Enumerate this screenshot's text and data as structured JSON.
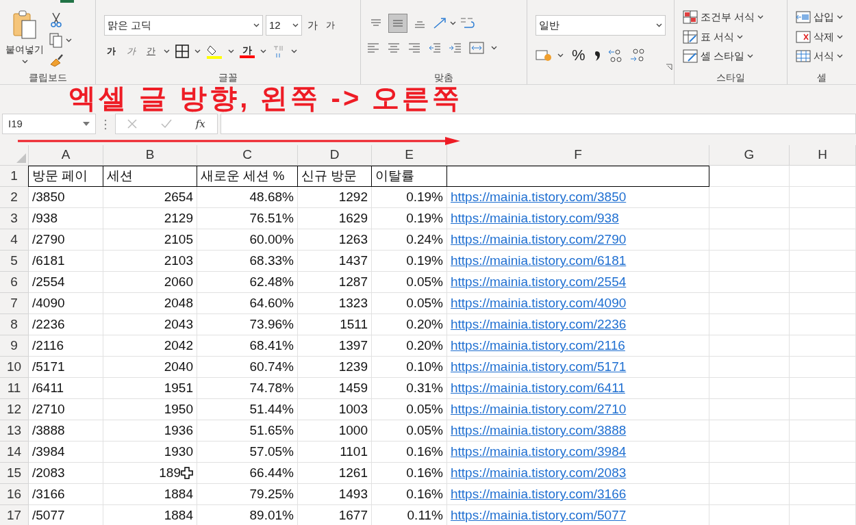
{
  "ribbon": {
    "clipboard": {
      "paste": "붙여넣기",
      "label": "클립보드"
    },
    "font": {
      "font_name": "맑은 고딕",
      "font_size": "12",
      "grow": "가",
      "shrink": "가",
      "bold": "가",
      "italic": "가",
      "underline": "간",
      "font_color": "가",
      "label": "글꼴"
    },
    "alignment": {
      "vertical": [
        {
          "selected": false
        },
        {
          "selected": true
        },
        {
          "selected": false
        }
      ],
      "label": "맞춤"
    },
    "number": {
      "format": "일반",
      "percent": "%"
    },
    "styles": {
      "items": [
        "조건부 서식",
        "표 서식",
        "셀 스타일"
      ],
      "label": "스타일"
    },
    "cells": {
      "items": [
        "삽입",
        "삭제",
        "서식"
      ],
      "label": "셀"
    }
  },
  "formula_bar": {
    "name_box": "I19",
    "fx": "fx"
  },
  "annotation": "엑셀 글 방향, 왼쪽 -> 오른쪽",
  "sheet": {
    "columns": [
      "A",
      "B",
      "C",
      "D",
      "E",
      "F",
      "G",
      "H"
    ],
    "rows": [
      {
        "number": "1",
        "cells": [
          "방문 페이",
          "세션",
          "새로운 세션 %",
          "신규 방문",
          "이탈률",
          ""
        ]
      },
      {
        "number": "2",
        "cells": [
          "/3850",
          "2654",
          "48.68%",
          "1292",
          "0.19%",
          "https://mainia.tistory.com/3850"
        ]
      },
      {
        "number": "3",
        "cells": [
          "/938",
          "2129",
          "76.51%",
          "1629",
          "0.19%",
          "https://mainia.tistory.com/938"
        ]
      },
      {
        "number": "4",
        "cells": [
          "/2790",
          "2105",
          "60.00%",
          "1263",
          "0.24%",
          "https://mainia.tistory.com/2790"
        ]
      },
      {
        "number": "5",
        "cells": [
          "/6181",
          "2103",
          "68.33%",
          "1437",
          "0.19%",
          "https://mainia.tistory.com/6181"
        ]
      },
      {
        "number": "6",
        "cells": [
          "/2554",
          "2060",
          "62.48%",
          "1287",
          "0.05%",
          "https://mainia.tistory.com/2554"
        ]
      },
      {
        "number": "7",
        "cells": [
          "/4090",
          "2048",
          "64.60%",
          "1323",
          "0.05%",
          "https://mainia.tistory.com/4090"
        ]
      },
      {
        "number": "8",
        "cells": [
          "/2236",
          "2043",
          "73.96%",
          "1511",
          "0.20%",
          "https://mainia.tistory.com/2236"
        ]
      },
      {
        "number": "9",
        "cells": [
          "/2116",
          "2042",
          "68.41%",
          "1397",
          "0.20%",
          "https://mainia.tistory.com/2116"
        ]
      },
      {
        "number": "10",
        "cells": [
          "/5171",
          "2040",
          "60.74%",
          "1239",
          "0.10%",
          "https://mainia.tistory.com/5171"
        ]
      },
      {
        "number": "11",
        "cells": [
          "/6411",
          "1951",
          "74.78%",
          "1459",
          "0.31%",
          "https://mainia.tistory.com/6411"
        ]
      },
      {
        "number": "12",
        "cells": [
          "/2710",
          "1950",
          "51.44%",
          "1003",
          "0.05%",
          "https://mainia.tistory.com/2710"
        ]
      },
      {
        "number": "13",
        "cells": [
          "/3888",
          "1936",
          "51.65%",
          "1000",
          "0.05%",
          "https://mainia.tistory.com/3888"
        ]
      },
      {
        "number": "14",
        "cells": [
          "/3984",
          "1930",
          "57.05%",
          "1101",
          "0.16%",
          "https://mainia.tistory.com/3984"
        ]
      },
      {
        "number": "15",
        "cells": [
          "/2083",
          "189",
          "66.44%",
          "1261",
          "0.16%",
          "https://mainia.tistory.com/2083"
        ],
        "cursor": true
      },
      {
        "number": "16",
        "cells": [
          "/3166",
          "1884",
          "79.25%",
          "1493",
          "0.16%",
          "https://mainia.tistory.com/3166"
        ]
      },
      {
        "number": "17",
        "cells": [
          "/5077",
          "1884",
          "89.01%",
          "1677",
          "0.11%",
          "https://mainia.tistory.com/5077"
        ]
      }
    ]
  }
}
